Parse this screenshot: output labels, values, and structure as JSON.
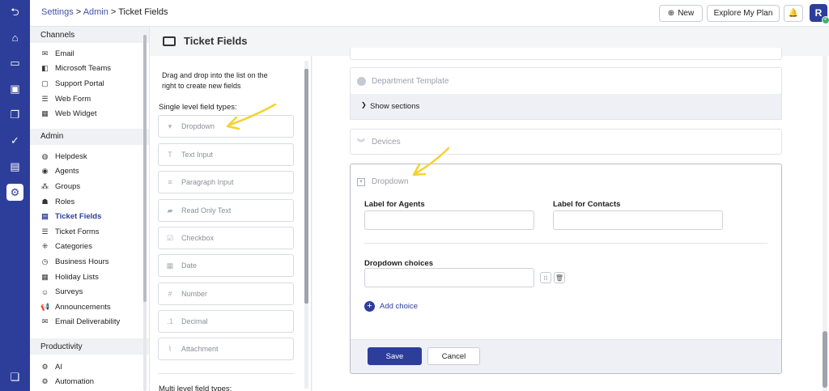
{
  "breadcrumb": {
    "settings": "Settings",
    "sep1": " > ",
    "admin": "Admin",
    "sep2": " > ",
    "current": "Ticket Fields"
  },
  "topbar": {
    "new_label": "New",
    "explore_label": "Explore My Plan",
    "avatar_letter": "R"
  },
  "nav": {
    "channels_header": "Channels",
    "channels": [
      "Email",
      "Microsoft Teams",
      "Support Portal",
      "Web Form",
      "Web Widget"
    ],
    "admin_header": "Admin",
    "admin": [
      "Helpdesk",
      "Agents",
      "Groups",
      "Roles",
      "Ticket Fields",
      "Ticket Forms",
      "Categories",
      "Business Hours",
      "Holiday Lists",
      "Surveys",
      "Announcements",
      "Email Deliverability"
    ],
    "productivity_header": "Productivity",
    "productivity": [
      "AI",
      "Automation"
    ]
  },
  "page": {
    "title": "Ticket Fields"
  },
  "palette": {
    "description": "Drag and drop into the list on the right to create new fields",
    "single_header": "Single level field types:",
    "types": [
      "Dropdown",
      "Text Input",
      "Paragraph Input",
      "Read Only Text",
      "Checkbox",
      "Date",
      "Number",
      "Decimal",
      "Attachment"
    ],
    "multi_header": "Multi level field types:"
  },
  "editor": {
    "department_template": "Department Template",
    "show_sections": "Show sections",
    "devices": "Devices",
    "dropdown_title": "Dropdown",
    "label_agents": "Label for Agents",
    "label_contacts": "Label for Contacts",
    "choices_label": "Dropdown choices",
    "add_choice": "Add choice",
    "save": "Save",
    "cancel": "Cancel"
  },
  "colors": {
    "brand": "#2d3e9a",
    "annotation_arrow": "#f5d232"
  }
}
